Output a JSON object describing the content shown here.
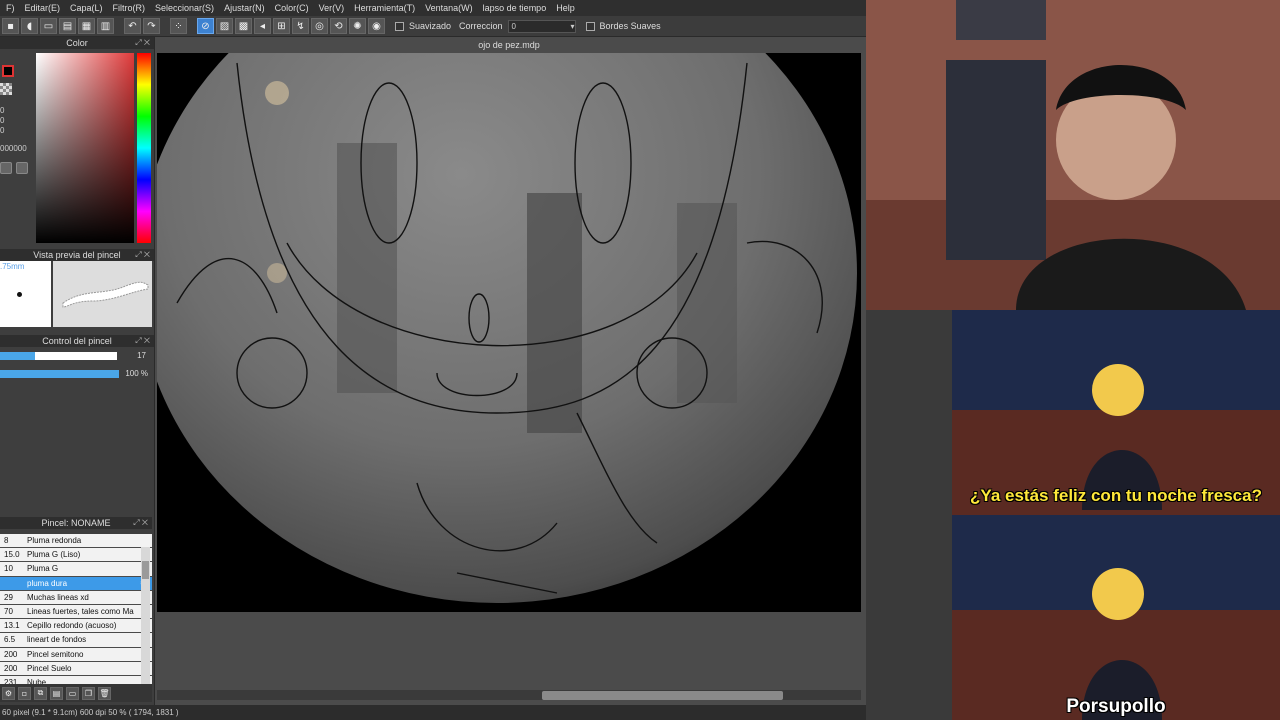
{
  "menubar": {
    "items": [
      "F)",
      "Editar(E)",
      "Capa(L)",
      "Filtro(R)",
      "Seleccionar(S)",
      "Ajustar(N)",
      "Color(C)",
      "Ver(V)",
      "Herramienta(T)",
      "Ventana(W)",
      "lapso de tiempo",
      "Help"
    ]
  },
  "toolbar": {
    "smoothing_label": "Suavizado",
    "correction_label": "Correccion",
    "correction_value": "0",
    "soft_edges_label": "Bordes Suaves"
  },
  "color_panel": {
    "title": "Color",
    "values": [
      "0",
      "0",
      "0"
    ],
    "hex_suffix": "000000"
  },
  "brush_preview": {
    "title": "Vista previa del pincel",
    "size_label": ".75mm"
  },
  "brush_control": {
    "title": "Control del pincel",
    "size_value": "17",
    "size_fraction": 0.3,
    "opacity_value": "100 %",
    "opacity_fraction": 1.0
  },
  "brush_list": {
    "title": "Pincel: NONAME",
    "items": [
      {
        "size": "8",
        "name": "Pluma redonda",
        "selected": false
      },
      {
        "size": "15.0",
        "name": "Pluma G (Liso)",
        "selected": false
      },
      {
        "size": "10",
        "name": "Pluma G",
        "selected": false
      },
      {
        "size": "",
        "name": "pluma dura",
        "selected": true
      },
      {
        "size": "29",
        "name": "Muchas lineas xd",
        "selected": false
      },
      {
        "size": "70",
        "name": "Lineas fuertes, tales como Ma",
        "selected": false
      },
      {
        "size": "13.1",
        "name": "Cepillo redondo (acuoso)",
        "selected": false
      },
      {
        "size": "6.5",
        "name": "lineart de fondos",
        "selected": false
      },
      {
        "size": "200",
        "name": "Pincel semitono",
        "selected": false
      },
      {
        "size": "200",
        "name": "Pincel Suelo",
        "selected": false
      },
      {
        "size": "231",
        "name": "Nube",
        "selected": false
      }
    ]
  },
  "document": {
    "title": "ojo de pez.mdp"
  },
  "statusbar": {
    "text": "60 pixel  (9.1 * 9.1cm)  600 dpi  50 %  ( 1794, 1831 )"
  },
  "meme": {
    "caption_top": "¿Ya estás feliz con tu noche fresca?",
    "caption_bottom": "Porsupollo"
  },
  "colors": {
    "accent": "#3d9ae8",
    "caption_yellow": "#ffe83a"
  }
}
